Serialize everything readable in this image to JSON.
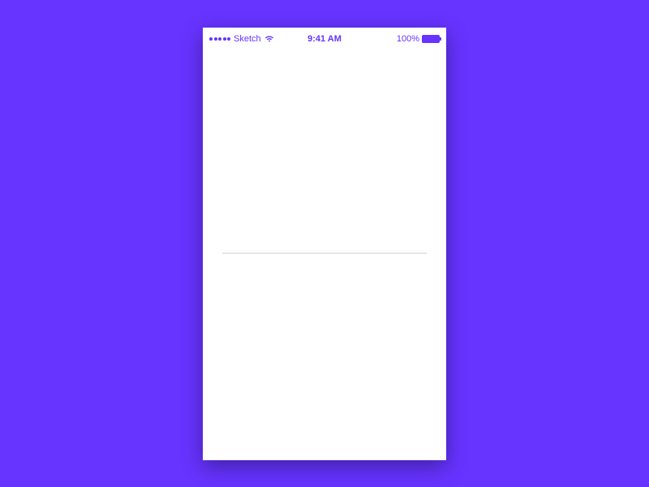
{
  "status_bar": {
    "carrier": "Sketch",
    "time": "9:41 AM",
    "battery_percent": "100%"
  },
  "colors": {
    "background": "#6633ff",
    "accent": "#6633ff",
    "divider": "#e6e6e6"
  }
}
